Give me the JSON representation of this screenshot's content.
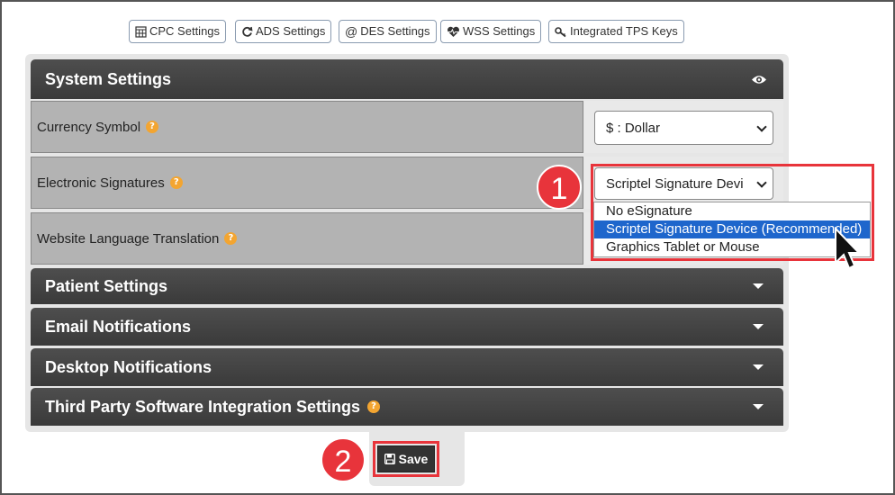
{
  "top_buttons": [
    {
      "label": "CPC Settings",
      "icon": "calculator-icon"
    },
    {
      "label": "ADS Settings",
      "icon": "refresh-icon"
    },
    {
      "label": "DES Settings",
      "icon": "at-icon"
    },
    {
      "label": "WSS Settings",
      "icon": "heartbeat-icon"
    },
    {
      "label": "Integrated TPS Keys",
      "icon": "key-icon"
    }
  ],
  "system_settings": {
    "title": "System Settings",
    "rows": [
      {
        "label": "Currency Symbol",
        "value": "$ : Dollar"
      },
      {
        "label": "Electronic Signatures",
        "value": "Scriptel Signature Devi"
      },
      {
        "label": "Website Language Translation"
      }
    ]
  },
  "signature_options": [
    "No eSignature",
    "Scriptel Signature Device (Recommended)",
    "Graphics Tablet or Mouse"
  ],
  "sections": [
    {
      "title": "Patient Settings"
    },
    {
      "title": "Email Notifications"
    },
    {
      "title": "Desktop Notifications"
    },
    {
      "title": "Third Party Software Integration Settings"
    }
  ],
  "save_label": "Save",
  "callouts": {
    "step1": "1",
    "step2": "2"
  },
  "colors": {
    "accent_red": "#e8343b",
    "header_dark": "#3f3f3f",
    "select_blue": "#1e66cc",
    "help_orange": "#f3a531"
  }
}
